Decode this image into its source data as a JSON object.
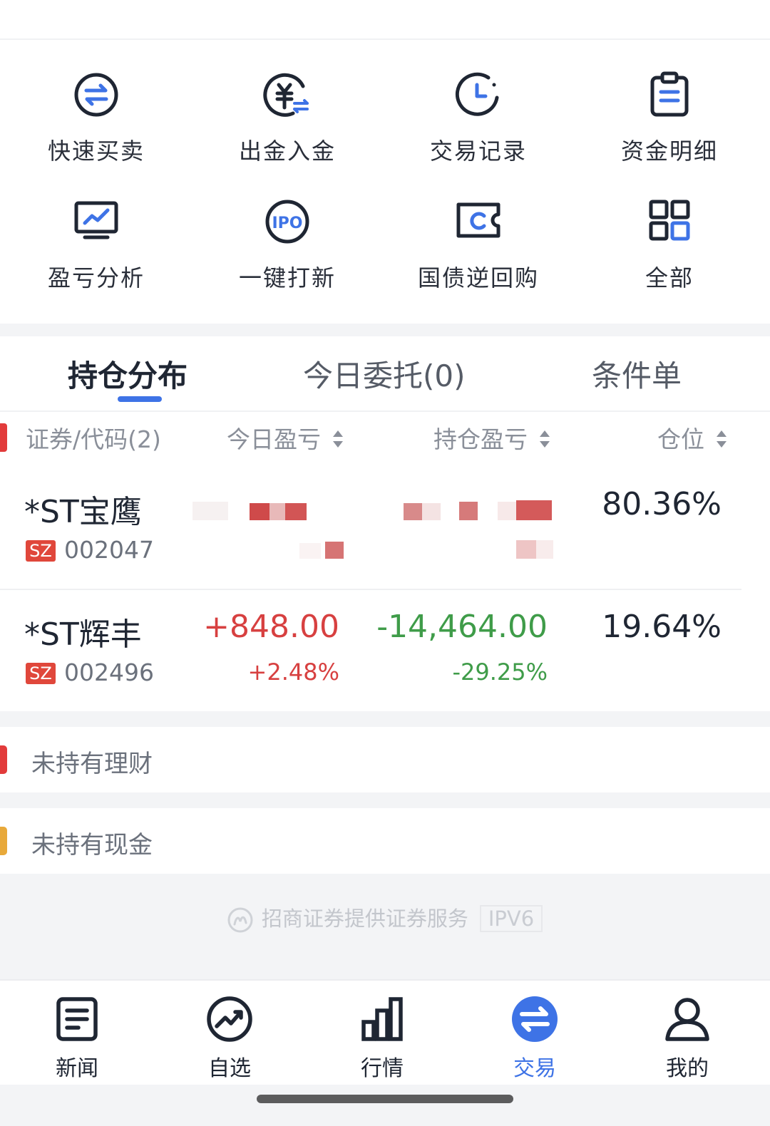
{
  "menu": [
    {
      "label": "快速买卖",
      "icon": "swap-circle-icon"
    },
    {
      "label": "出金入金",
      "icon": "yuan-transfer-icon"
    },
    {
      "label": "交易记录",
      "icon": "clock-icon"
    },
    {
      "label": "资金明细",
      "icon": "clipboard-icon"
    },
    {
      "label": "盈亏分析",
      "icon": "monitor-chart-icon"
    },
    {
      "label": "一键打新",
      "icon": "ipo-icon"
    },
    {
      "label": "国债逆回购",
      "icon": "ticket-icon"
    },
    {
      "label": "全部",
      "icon": "grid-icon"
    }
  ],
  "tabs": [
    {
      "label": "持仓分布",
      "active": true
    },
    {
      "label": "今日委托(0)",
      "active": false
    },
    {
      "label": "条件单",
      "active": false
    }
  ],
  "columns": {
    "security": "证券/代码(2)",
    "today_pl": "今日盈亏",
    "hold_pl": "持仓盈亏",
    "position": "仓位"
  },
  "holdings": [
    {
      "name": "*ST宝鹰",
      "exchange": "SZ",
      "code": "002047",
      "today_pl": "",
      "today_pl_pct": "",
      "hold_pl": "",
      "hold_pl_pct": "",
      "position": "80.36%"
    },
    {
      "name": "*ST辉丰",
      "exchange": "SZ",
      "code": "002496",
      "today_pl": "+848.00",
      "today_pl_pct": "+2.48%",
      "hold_pl": "-14,464.00",
      "hold_pl_pct": "-29.25%",
      "position": "19.64%"
    }
  ],
  "info_rows": [
    {
      "label": "未持有理财",
      "marker_color": "#e23b3b"
    },
    {
      "label": "未持有现金",
      "marker_color": "#e8a93a"
    }
  ],
  "footer": {
    "service_text": "招商证券提供证券服务",
    "ipv_badge": "IPV6"
  },
  "bottom_nav": [
    {
      "label": "新闻",
      "icon": "news-icon",
      "active": false
    },
    {
      "label": "自选",
      "icon": "trend-circle-icon",
      "active": false
    },
    {
      "label": "行情",
      "icon": "bar-chart-icon",
      "active": false
    },
    {
      "label": "交易",
      "icon": "swap-circle-icon",
      "active": true
    },
    {
      "label": "我的",
      "icon": "user-icon",
      "active": false
    }
  ],
  "colors": {
    "accent": "#3e73e6",
    "up": "#d74040",
    "down": "#3f9c49",
    "badge": "#e0473b"
  }
}
